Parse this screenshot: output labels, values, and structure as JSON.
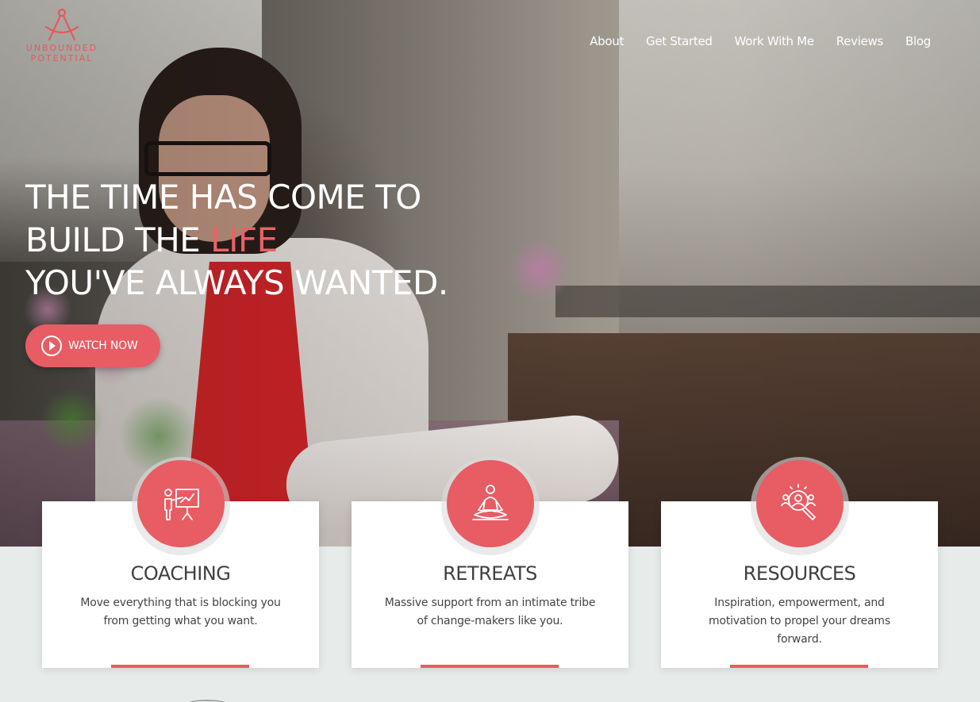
{
  "logo": {
    "line1": "UNBOUNDED",
    "line2": "POTENTIAL",
    "icon": "compass-a-icon"
  },
  "nav": {
    "items": [
      "About",
      "Get Started",
      "Work With Me",
      "Reviews",
      "Blog"
    ]
  },
  "hero": {
    "line1": "THE TIME HAS COME TO",
    "line2_pre": "BUILD THE ",
    "line2_accent": "LIFE",
    "line3": "YOU'VE ALWAYS WANTED.",
    "button_label": "WATCH NOW",
    "button_icon": "play-circle-icon"
  },
  "cards": [
    {
      "icon": "presentation-icon",
      "title": "COACHING",
      "text": "Move everything that is blocking you from getting what you want."
    },
    {
      "icon": "meditation-icon",
      "title": "RETREATS",
      "text": "Massive support from an intimate tribe of change-makers like you."
    },
    {
      "icon": "people-search-icon",
      "title": "RESOURCES",
      "text": "Inspiration, empowerment, and motivation to propel your dreams forward."
    }
  ],
  "colors": {
    "accent": "#e85c64",
    "background": "#e7ebea",
    "card": "#ffffff",
    "heading": "#3f3f3f"
  }
}
